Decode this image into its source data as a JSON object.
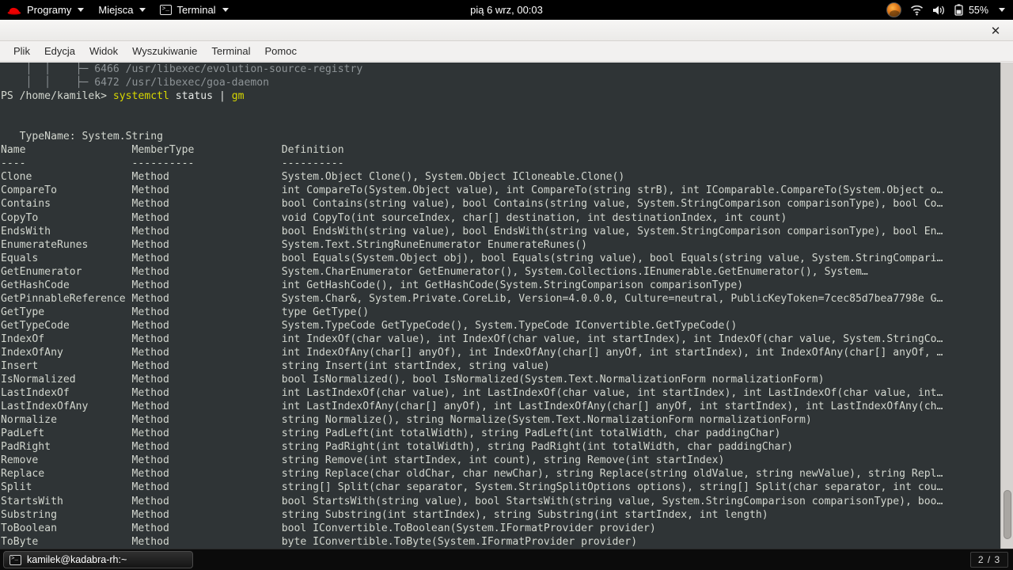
{
  "panel": {
    "menus": [
      {
        "label": "Programy",
        "icon": "redhat-logo-icon"
      },
      {
        "label": "Miejsca",
        "icon": null
      },
      {
        "label": "Terminal",
        "icon": "terminal-icon"
      }
    ],
    "clock": "pią 6 wrz, 00:03",
    "tray": {
      "avatar": "user-avatar-icon",
      "wifi": "wifi-icon",
      "volume": "volume-icon",
      "battery_icon": "battery-icon",
      "battery": "55%"
    }
  },
  "window": {
    "close_label": "✕",
    "menubar": [
      "Plik",
      "Edycja",
      "Widok",
      "Wyszukiwanie",
      "Terminal",
      "Pomoc"
    ]
  },
  "terminal": {
    "colors": {
      "background": "#2f3436",
      "foreground": "#d3d7cf",
      "accent_yellow": "#d7d700",
      "dim": "#8d9396"
    },
    "prompt": "PS /home/kamilek>",
    "command_tokens": [
      {
        "text": "systemctl",
        "color": "yellow"
      },
      {
        "text": " status ",
        "color": "white"
      },
      {
        "text": "|",
        "color": "white"
      },
      {
        "text": " gm",
        "color": "yellow"
      }
    ],
    "scrollback_tail": [
      "    │  │    ├─ 6466 /usr/libexec/evolution-source-registry",
      "    │  │    ├─ 6472 /usr/libexec/goa-daemon"
    ],
    "typename_line": "   TypeName: System.String",
    "columns": {
      "name": "Name",
      "membertype": "MemberType",
      "definition": "Definition"
    },
    "underlines": {
      "name": "----",
      "membertype": "----------",
      "definition": "----------"
    },
    "rows": [
      {
        "name": "Clone",
        "membertype": "Method",
        "definition": "System.Object Clone(), System.Object ICloneable.Clone()"
      },
      {
        "name": "CompareTo",
        "membertype": "Method",
        "definition": "int CompareTo(System.Object value), int CompareTo(string strB), int IComparable.CompareTo(System.Object o…"
      },
      {
        "name": "Contains",
        "membertype": "Method",
        "definition": "bool Contains(string value), bool Contains(string value, System.StringComparison comparisonType), bool Co…"
      },
      {
        "name": "CopyTo",
        "membertype": "Method",
        "definition": "void CopyTo(int sourceIndex, char[] destination, int destinationIndex, int count)"
      },
      {
        "name": "EndsWith",
        "membertype": "Method",
        "definition": "bool EndsWith(string value), bool EndsWith(string value, System.StringComparison comparisonType), bool En…"
      },
      {
        "name": "EnumerateRunes",
        "membertype": "Method",
        "definition": "System.Text.StringRuneEnumerator EnumerateRunes()"
      },
      {
        "name": "Equals",
        "membertype": "Method",
        "definition": "bool Equals(System.Object obj), bool Equals(string value), bool Equals(string value, System.StringCompari…"
      },
      {
        "name": "GetEnumerator",
        "membertype": "Method",
        "definition": "System.CharEnumerator GetEnumerator(), System.Collections.IEnumerable.GetEnumerator(), System…"
      },
      {
        "name": "GetHashCode",
        "membertype": "Method",
        "definition": "int GetHashCode(), int GetHashCode(System.StringComparison comparisonType)"
      },
      {
        "name": "GetPinnableReference",
        "membertype": "Method",
        "definition": "System.Char&, System.Private.CoreLib, Version=4.0.0.0, Culture=neutral, PublicKeyToken=7cec85d7bea7798e G…"
      },
      {
        "name": "GetType",
        "membertype": "Method",
        "definition": "type GetType()"
      },
      {
        "name": "GetTypeCode",
        "membertype": "Method",
        "definition": "System.TypeCode GetTypeCode(), System.TypeCode IConvertible.GetTypeCode()"
      },
      {
        "name": "IndexOf",
        "membertype": "Method",
        "definition": "int IndexOf(char value), int IndexOf(char value, int startIndex), int IndexOf(char value, System.StringCo…"
      },
      {
        "name": "IndexOfAny",
        "membertype": "Method",
        "definition": "int IndexOfAny(char[] anyOf), int IndexOfAny(char[] anyOf, int startIndex), int IndexOfAny(char[] anyOf, …"
      },
      {
        "name": "Insert",
        "membertype": "Method",
        "definition": "string Insert(int startIndex, string value)"
      },
      {
        "name": "IsNormalized",
        "membertype": "Method",
        "definition": "bool IsNormalized(), bool IsNormalized(System.Text.NormalizationForm normalizationForm)"
      },
      {
        "name": "LastIndexOf",
        "membertype": "Method",
        "definition": "int LastIndexOf(char value), int LastIndexOf(char value, int startIndex), int LastIndexOf(char value, int…"
      },
      {
        "name": "LastIndexOfAny",
        "membertype": "Method",
        "definition": "int LastIndexOfAny(char[] anyOf), int LastIndexOfAny(char[] anyOf, int startIndex), int LastIndexOfAny(ch…"
      },
      {
        "name": "Normalize",
        "membertype": "Method",
        "definition": "string Normalize(), string Normalize(System.Text.NormalizationForm normalizationForm)"
      },
      {
        "name": "PadLeft",
        "membertype": "Method",
        "definition": "string PadLeft(int totalWidth), string PadLeft(int totalWidth, char paddingChar)"
      },
      {
        "name": "PadRight",
        "membertype": "Method",
        "definition": "string PadRight(int totalWidth), string PadRight(int totalWidth, char paddingChar)"
      },
      {
        "name": "Remove",
        "membertype": "Method",
        "definition": "string Remove(int startIndex, int count), string Remove(int startIndex)"
      },
      {
        "name": "Replace",
        "membertype": "Method",
        "definition": "string Replace(char oldChar, char newChar), string Replace(string oldValue, string newValue), string Repl…"
      },
      {
        "name": "Split",
        "membertype": "Method",
        "definition": "string[] Split(char separator, System.StringSplitOptions options), string[] Split(char separator, int cou…"
      },
      {
        "name": "StartsWith",
        "membertype": "Method",
        "definition": "bool StartsWith(string value), bool StartsWith(string value, System.StringComparison comparisonType), boo…"
      },
      {
        "name": "Substring",
        "membertype": "Method",
        "definition": "string Substring(int startIndex), string Substring(int startIndex, int length)"
      },
      {
        "name": "ToBoolean",
        "membertype": "Method",
        "definition": "bool IConvertible.ToBoolean(System.IFormatProvider provider)"
      },
      {
        "name": "ToByte",
        "membertype": "Method",
        "definition": "byte IConvertible.ToByte(System.IFormatProvider provider)"
      }
    ]
  },
  "taskbar": {
    "task_label": "kamilek@kadabra-rh:~",
    "task_icon": "terminal-icon",
    "workspace": "2 / 3"
  }
}
